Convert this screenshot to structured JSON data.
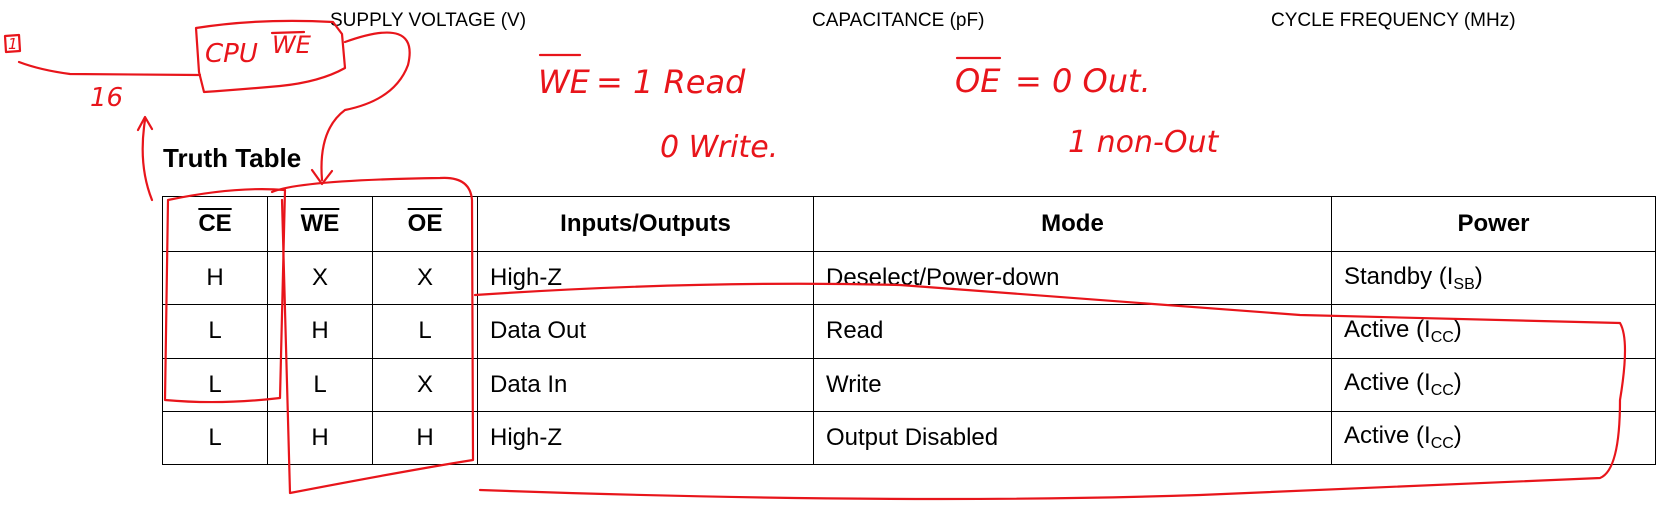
{
  "header": {
    "supply_voltage": "SUPPLY VOLTAGE (V)",
    "capacitance": "CAPACITANCE (pF)",
    "cycle_frequency": "CYCLE FREQUENCY (MHz)"
  },
  "title": "Truth Table",
  "table": {
    "columns": [
      "CE",
      "WE",
      "OE",
      "Inputs/Outputs",
      "Mode",
      "Power"
    ],
    "rows": [
      {
        "ce": "H",
        "we": "X",
        "oe": "X",
        "io": "High-Z",
        "mode": "Deselect/Power-down",
        "power": "Standby (I",
        "power_sub": "SB",
        "power_end": ")"
      },
      {
        "ce": "L",
        "we": "H",
        "oe": "L",
        "io": "Data Out",
        "mode": "Read",
        "power": "Active (I",
        "power_sub": "CC",
        "power_end": ")"
      },
      {
        "ce": "L",
        "we": "L",
        "oe": "X",
        "io": "Data In",
        "mode": "Write",
        "power": "Active (I",
        "power_sub": "CC",
        "power_end": ")"
      },
      {
        "ce": "L",
        "we": "H",
        "oe": "H",
        "io": "High-Z",
        "mode": "Output Disabled",
        "power": "Active (I",
        "power_sub": "CC",
        "power_end": ")"
      }
    ]
  },
  "annotations": {
    "box_label": "1",
    "sixteen": "16",
    "cpu": "CPU",
    "cpu_we": "WE",
    "we_label": "WE",
    "we_read": "= 1 Read",
    "we_write": "0 Write.",
    "oe_label": "OE",
    "oe_out": "= 0 Out.",
    "oe_nonout": "1 non-Out",
    "ink_color": "#e8151b"
  }
}
